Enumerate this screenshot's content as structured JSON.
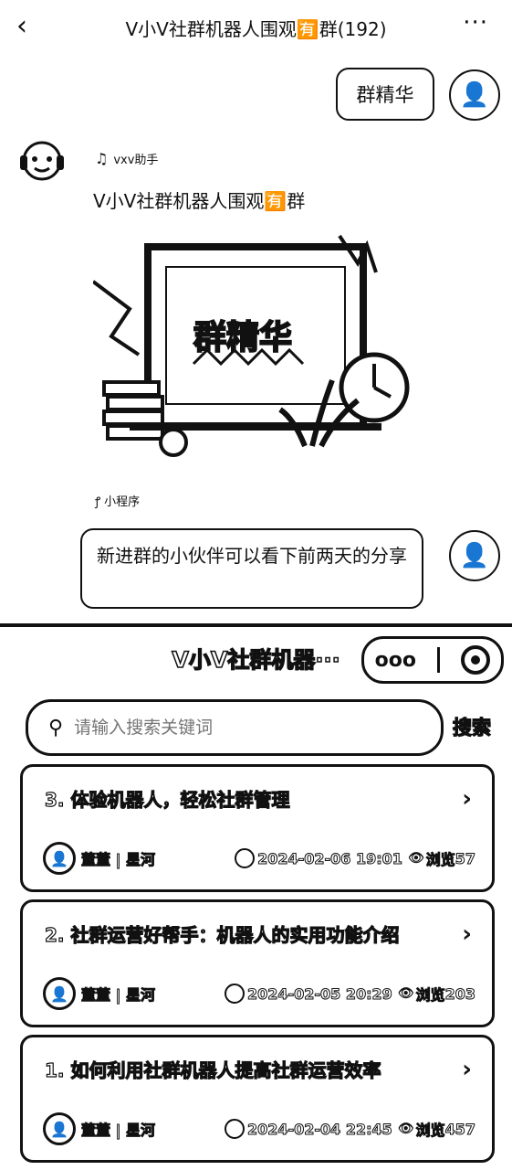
{
  "header": {
    "back_icon": "chevron-left-icon",
    "title": "V小V社群机器人围观🈶群(192)",
    "more_icon": "more-icon"
  },
  "chat": {
    "msg1": {
      "text": "群精华"
    },
    "msg2": {
      "sender": "vxv助手",
      "card_title": "V小V社群机器人围观🈶群",
      "card_image_text": "群精华",
      "card_footer": "小程序"
    },
    "msg3": {
      "text": "新进群的小伙伴可以看下前两天的分享"
    }
  },
  "miniprogram": {
    "title": "V小V社群机器···",
    "search_placeholder": "请输入搜索关键词",
    "search_button": "搜索",
    "items": [
      {
        "title": "3. 体验机器人，轻松社群管理",
        "author": "董董 | 星河",
        "time": "2024-02-06 19:01",
        "views_label": "浏览",
        "views": "57"
      },
      {
        "title": "2. 社群运营好帮手：机器人的实用功能介绍",
        "author": "董董 | 星河",
        "time": "2024-02-05 20:29",
        "views_label": "浏览",
        "views": "203"
      },
      {
        "title": "1. 如何利用社群机器人提高社群运营效率",
        "author": "董董 | 星河",
        "time": "2024-02-04 22:45",
        "views_label": "浏览",
        "views": "457"
      }
    ]
  }
}
